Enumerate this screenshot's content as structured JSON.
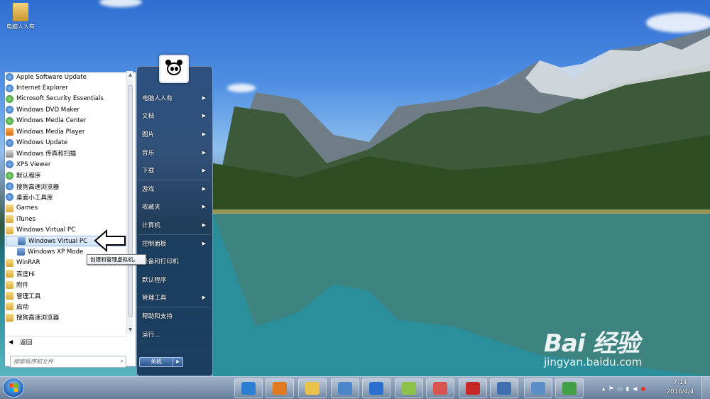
{
  "desktop": {
    "icons": [
      {
        "label": "电脑人人有"
      }
    ]
  },
  "start_menu": {
    "programs": [
      {
        "label": "Apple Software Update",
        "icon": "apple-update-icon",
        "kind": "blue"
      },
      {
        "label": "Internet Explorer",
        "icon": "ie-icon",
        "kind": "blue"
      },
      {
        "label": "Microsoft Security Essentials",
        "icon": "security-essentials-icon",
        "kind": "green"
      },
      {
        "label": "Windows DVD Maker",
        "icon": "dvd-maker-icon",
        "kind": "blue"
      },
      {
        "label": "Windows Media Center",
        "icon": "media-center-icon",
        "kind": "green"
      },
      {
        "label": "Windows Media Player",
        "icon": "media-player-icon",
        "kind": "orange"
      },
      {
        "label": "Windows Update",
        "icon": "windows-update-icon",
        "kind": "blue"
      },
      {
        "label": "Windows 传真和扫描",
        "icon": "fax-scan-icon",
        "kind": "gray"
      },
      {
        "label": "XPS Viewer",
        "icon": "xps-viewer-icon",
        "kind": "blue"
      },
      {
        "label": "默认程序",
        "icon": "default-programs-icon",
        "kind": "green"
      },
      {
        "label": "搜狗高速浏览器",
        "icon": "sogou-browser-icon",
        "kind": "blue"
      },
      {
        "label": "桌面小工具库",
        "icon": "gadgets-icon",
        "kind": "blue"
      },
      {
        "label": "Games",
        "icon": "folder-icon",
        "kind": "folder"
      },
      {
        "label": "iTunes",
        "icon": "folder-icon",
        "kind": "folder"
      },
      {
        "label": "Windows Virtual PC",
        "icon": "folder-icon",
        "kind": "folder"
      },
      {
        "label": "Windows Virtual PC",
        "icon": "virtual-pc-icon",
        "kind": "vpc",
        "sub": true,
        "selected": true
      },
      {
        "label": "Windows XP Mode",
        "icon": "xp-mode-icon",
        "kind": "vpc",
        "sub": true
      },
      {
        "label": "WinRAR",
        "icon": "folder-icon",
        "kind": "folder"
      },
      {
        "label": "百度Hi",
        "icon": "folder-icon",
        "kind": "folder"
      },
      {
        "label": "附件",
        "icon": "folder-icon",
        "kind": "folder"
      },
      {
        "label": "管理工具",
        "icon": "folder-icon",
        "kind": "folder"
      },
      {
        "label": "启动",
        "icon": "folder-icon",
        "kind": "folder"
      },
      {
        "label": "搜狗高速浏览器",
        "icon": "folder-icon",
        "kind": "folder"
      }
    ],
    "back_label": "返回",
    "search_placeholder": "搜索程序和文件",
    "tooltip": "创建和管理虚拟机。",
    "right_items": [
      {
        "label": "电脑人人有",
        "arrow": true
      },
      {
        "label": "文档",
        "arrow": true
      },
      {
        "label": "图片",
        "arrow": true
      },
      {
        "label": "音乐",
        "arrow": true
      },
      {
        "label": "下载",
        "arrow": true
      },
      {
        "label": "游戏",
        "arrow": true
      },
      {
        "label": "收藏夹",
        "arrow": true
      },
      {
        "label": "计算机",
        "arrow": true
      },
      {
        "label": "控制面板",
        "arrow": true
      },
      {
        "label": "设备和打印机",
        "arrow": false
      },
      {
        "label": "默认程序",
        "arrow": false
      },
      {
        "label": "管理工具",
        "arrow": true
      },
      {
        "label": "帮助和支持",
        "arrow": false
      },
      {
        "label": "运行...",
        "arrow": false
      }
    ],
    "shutdown_label": "关机"
  },
  "taskbar": {
    "pinned": [
      {
        "name": "ie-icon",
        "color": "#2a7fd4"
      },
      {
        "name": "media-player-icon",
        "color": "#e07a1e"
      },
      {
        "name": "explorer-icon",
        "color": "#e8c24a"
      },
      {
        "name": "network-icon",
        "color": "#4a86c8"
      },
      {
        "name": "sogou-icon",
        "color": "#2a6fd0"
      },
      {
        "name": "folder-icon",
        "color": "#8bc34a"
      },
      {
        "name": "paint-icon",
        "color": "#d9534f"
      },
      {
        "name": "chess-icon",
        "color": "#c62828"
      },
      {
        "name": "virtual-pc-icon",
        "color": "#3f6fb0"
      },
      {
        "name": "remote-desktop-icon",
        "color": "#5a8fc8"
      },
      {
        "name": "download-icon",
        "color": "#43a047"
      }
    ],
    "clock_time": "7:14",
    "clock_date": "2016/4/4"
  },
  "watermark": {
    "logo": "Bai 经验",
    "url": "jingyan.baidu.com"
  }
}
